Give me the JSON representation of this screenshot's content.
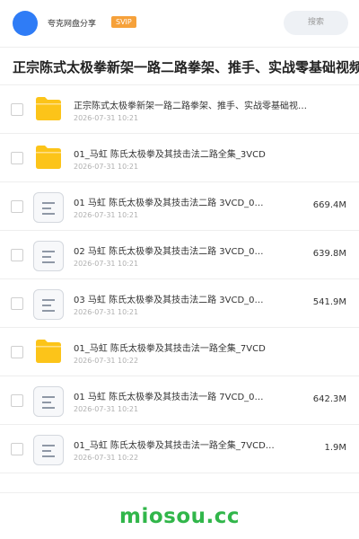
{
  "header": {
    "brand": "夸克网盘分享",
    "badge": "SVIP",
    "search_placeholder": "搜索"
  },
  "title": "正宗陈式太极拳新架一路二路拳架、推手、实战零基础视频",
  "files": [
    {
      "type": "folder",
      "name": "正宗陈式太极拳新架一路二路拳架、推手、实战零基础视…",
      "date": "2026-07-31 10:21",
      "size": ""
    },
    {
      "type": "folder",
      "name": "01_马虹 陈氏太极拳及其技击法二路全集_3VCD",
      "date": "2026-07-31 10:21",
      "size": ""
    },
    {
      "type": "file",
      "name": "01 马虹 陈氏太极拳及其技击法二路 3VCD_0…",
      "date": "2026-07-31 10:21",
      "size": "669.4M"
    },
    {
      "type": "file",
      "name": "02 马虹 陈氏太极拳及其技击法二路 3VCD_0…",
      "date": "2026-07-31 10:21",
      "size": "639.8M"
    },
    {
      "type": "file",
      "name": "03 马虹 陈氏太极拳及其技击法二路 3VCD_0…",
      "date": "2026-07-31 10:21",
      "size": "541.9M"
    },
    {
      "type": "folder",
      "name": "01_马虹 陈氏太极拳及其技击法一路全集_7VCD",
      "date": "2026-07-31 10:22",
      "size": ""
    },
    {
      "type": "file",
      "name": "01 马虹 陈氏太极拳及其技击法一路 7VCD_0…",
      "date": "2026-07-31 10:21",
      "size": "642.3M"
    },
    {
      "type": "file",
      "name": "01_马虹 陈氏太极拳及其技击法一路全集_7VCD…",
      "date": "2026-07-31 10:22",
      "size": "1.9M"
    }
  ],
  "footer": {
    "watermark": "miosou.cc"
  },
  "colors": {
    "accent": "#2f7cf6",
    "badge": "#f6a13a",
    "folder": "#fcc419",
    "watermark": "#31b64a"
  }
}
